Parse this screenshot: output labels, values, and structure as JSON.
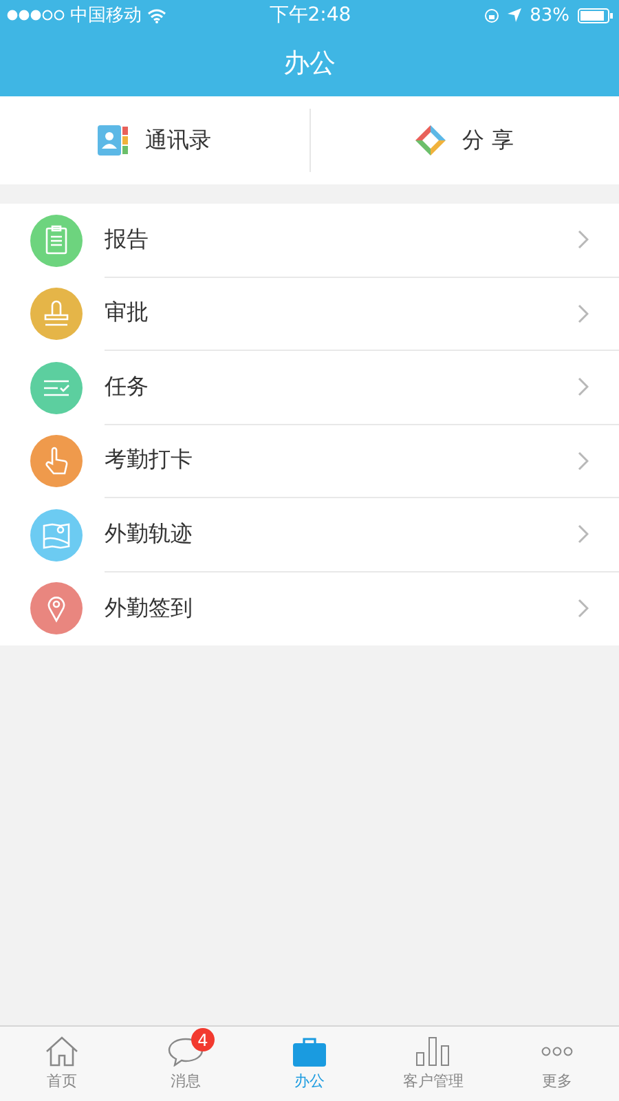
{
  "status_bar": {
    "carrier": "中国移动",
    "time": "下午2:48",
    "battery": "83%"
  },
  "header": {
    "title": "办公"
  },
  "shortcuts": [
    {
      "kind": "contacts",
      "label": "通讯录"
    },
    {
      "kind": "share",
      "label": "分 享"
    }
  ],
  "menu": [
    {
      "kind": "report",
      "label": "报告",
      "color": "#6dd47e"
    },
    {
      "kind": "stamp",
      "label": "审批",
      "color": "#e5b548"
    },
    {
      "kind": "task",
      "label": "任务",
      "color": "#5ccf9f"
    },
    {
      "kind": "hand",
      "label": "考勤打卡",
      "color": "#ef9a4c"
    },
    {
      "kind": "map",
      "label": "外勤轨迹",
      "color": "#6ccbf2"
    },
    {
      "kind": "pin",
      "label": "外勤签到",
      "color": "#e9867f"
    }
  ],
  "tabs": [
    {
      "kind": "home",
      "label": "首页",
      "selected": false
    },
    {
      "kind": "chat",
      "label": "消息",
      "selected": false,
      "badge": "4"
    },
    {
      "kind": "briefcase",
      "label": "办公",
      "selected": true
    },
    {
      "kind": "chart",
      "label": "客户管理",
      "selected": false
    },
    {
      "kind": "more",
      "label": "更多",
      "selected": false
    }
  ]
}
